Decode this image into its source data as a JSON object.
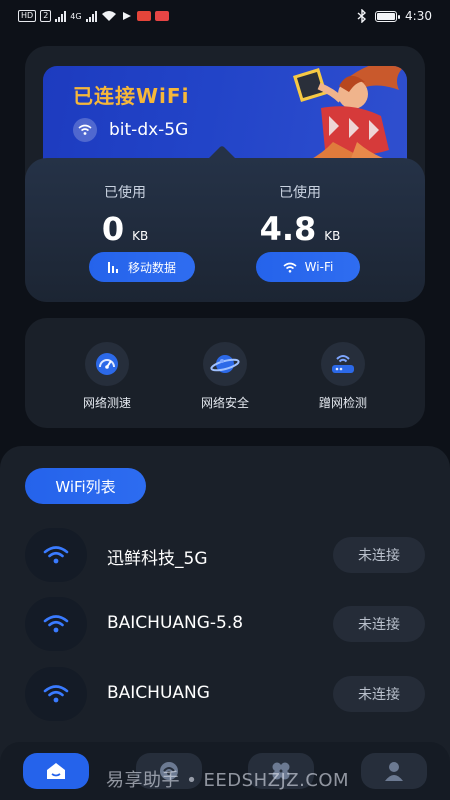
{
  "status_bar": {
    "left_chip": "HD",
    "left_chip2": "2",
    "network_label": "4G",
    "time": "4:30",
    "app_colors": [
      "#e4453a",
      "#e64545"
    ]
  },
  "banner": {
    "title": "已连接WiFi",
    "ssid": "bit-dx-5G",
    "title_color": "#f6b73a"
  },
  "stats": {
    "mobile": {
      "label": "已使用",
      "value": "0",
      "unit": "KB",
      "button": "移动数据"
    },
    "wifi": {
      "label": "已使用",
      "value": "4.8",
      "unit": "KB",
      "button": "Wi-Fi"
    }
  },
  "tools": [
    {
      "label": "网络测速",
      "icon": "speedometer-icon"
    },
    {
      "label": "网络安全",
      "icon": "planet-shield-icon"
    },
    {
      "label": "蹭网检测",
      "icon": "router-icon"
    }
  ],
  "wifi_list": {
    "title": "WiFi列表",
    "networks": [
      {
        "name": "迅鲜科技_5G",
        "status": "未连接"
      },
      {
        "name": "BAICHUANG-5.8",
        "status": "未连接"
      },
      {
        "name": "BAICHUANG",
        "status": "未连接"
      }
    ]
  },
  "nav": {
    "items": [
      "home-icon",
      "signal-icon",
      "apps-icon",
      "profile-icon"
    ],
    "active": "home-icon"
  },
  "watermark": "易享助手 • EEDSHZJZ.COM",
  "colors": {
    "accent": "#2563eb",
    "background": "#0d1118",
    "card": "#1a2029"
  }
}
